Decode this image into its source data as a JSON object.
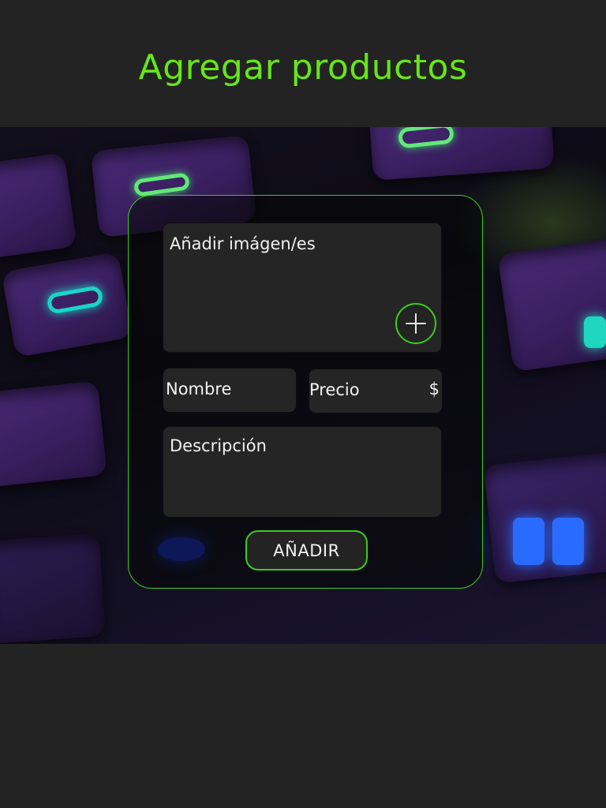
{
  "header": {
    "title": "Agregar productos"
  },
  "form": {
    "images_label": "Añadir imágen/es",
    "add_image_icon": "plus-icon",
    "name_placeholder": "Nombre",
    "price_placeholder": "Precio",
    "currency_symbol": "$",
    "description_placeholder": "Descripción",
    "submit_label": "AÑADIR"
  },
  "colors": {
    "accent": "#66e617",
    "border_accent": "#3dcb1d",
    "background": "#232323",
    "field_background": "#252525",
    "text": "#f2f2f2"
  }
}
